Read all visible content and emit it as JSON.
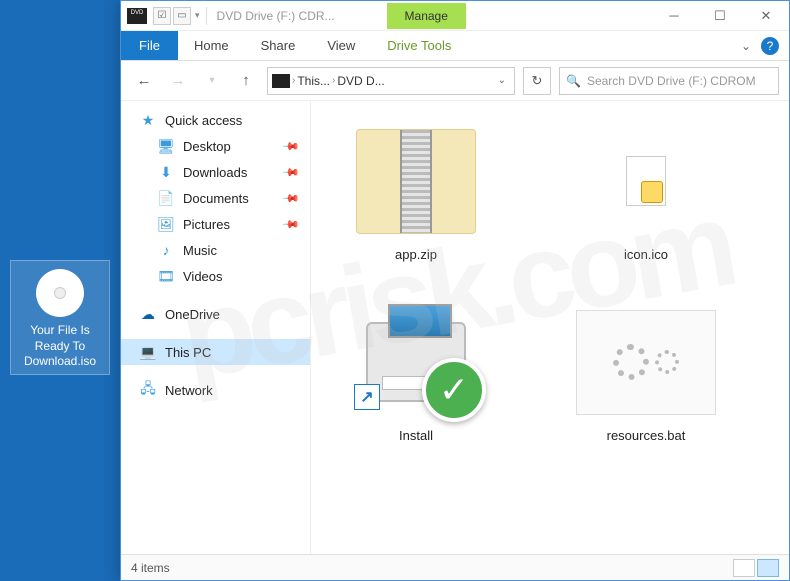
{
  "desktop": {
    "iso_label": "Your File Is Ready To Download.iso"
  },
  "window": {
    "title": "DVD Drive (F:) CDR...",
    "manage_tab": "Manage",
    "drive_tools": "Drive Tools"
  },
  "ribbon": {
    "file": "File",
    "home": "Home",
    "share": "Share",
    "view": "View"
  },
  "breadcrumb": {
    "seg1": "This...",
    "seg2": "DVD D..."
  },
  "search": {
    "placeholder": "Search DVD Drive (F:) CDROM"
  },
  "sidebar": {
    "quick_access": "Quick access",
    "desktop": "Desktop",
    "downloads": "Downloads",
    "documents": "Documents",
    "pictures": "Pictures",
    "music": "Music",
    "videos": "Videos",
    "onedrive": "OneDrive",
    "this_pc": "This PC",
    "network": "Network"
  },
  "files": {
    "app_zip": "app.zip",
    "icon_ico": "icon.ico",
    "install": "Install",
    "resources_bat": "resources.bat"
  },
  "status": {
    "count": "4 items"
  },
  "watermark": "pcrisk.com"
}
